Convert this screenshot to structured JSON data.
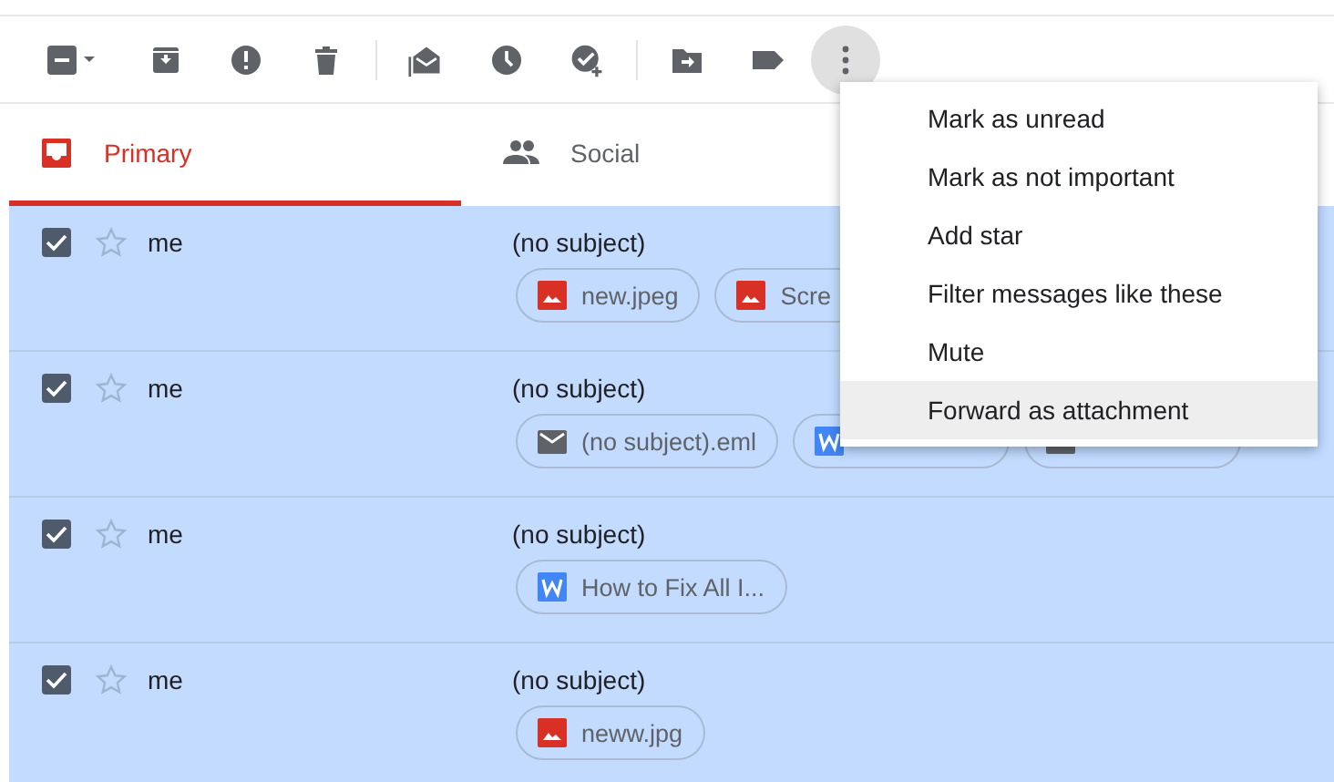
{
  "toolbar": {
    "select_checkbox": {
      "checked": true,
      "partial": true
    },
    "more_menu_open": true
  },
  "tabs": [
    {
      "label": "Primary",
      "selected": true
    },
    {
      "label": "Social",
      "selected": false
    }
  ],
  "messages": [
    {
      "sender": "me",
      "checked": true,
      "starred": false,
      "subject": "(no subject)",
      "attachments": [
        {
          "kind": "image",
          "name": "new.jpeg"
        },
        {
          "kind": "image",
          "name": "Scre",
          "clipped": true
        }
      ]
    },
    {
      "sender": "me",
      "checked": true,
      "starred": false,
      "subject": "(no subject)",
      "attachments": [
        {
          "kind": "email",
          "name": "(no subject).eml"
        },
        {
          "kind": "word",
          "clipped": true
        },
        {
          "kind": "email",
          "clipped": true
        }
      ]
    },
    {
      "sender": "me",
      "checked": true,
      "starred": false,
      "subject": "(no subject)",
      "attachments": [
        {
          "kind": "word",
          "name": "How to Fix All I..."
        }
      ]
    },
    {
      "sender": "me",
      "checked": true,
      "starred": false,
      "subject": "(no subject)",
      "attachments": [
        {
          "kind": "image",
          "name": "neww.jpg"
        }
      ]
    }
  ],
  "menu": [
    {
      "label": "Mark as unread",
      "selected": false
    },
    {
      "label": "Mark as not important",
      "selected": false
    },
    {
      "label": "Add star",
      "selected": false
    },
    {
      "label": "Filter messages like these",
      "selected": false
    },
    {
      "label": "Mute",
      "selected": false
    },
    {
      "label": "Forward as attachment",
      "selected": true
    }
  ]
}
